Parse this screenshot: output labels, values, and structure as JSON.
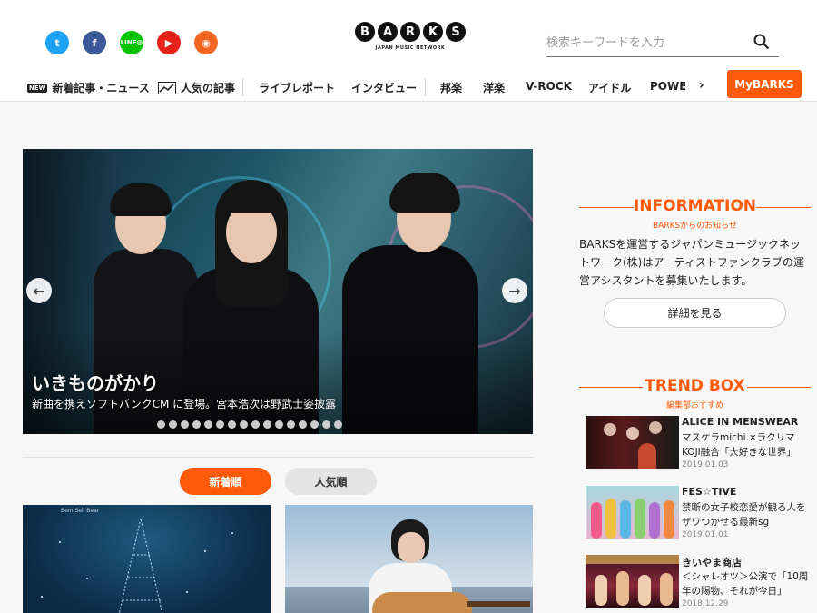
{
  "header": {
    "logo_letters": [
      "B",
      "A",
      "R",
      "K",
      "S"
    ],
    "logo_sub": "JAPAN MUSIC NETWORK",
    "social_icons": [
      "twitter-icon",
      "facebook-icon",
      "line-icon",
      "youtube-icon",
      "rss-icon"
    ],
    "line_label": "LINE@",
    "search_placeholder": "検索キーワードを入力",
    "mybarks_label": "MyBARKS"
  },
  "nav": {
    "new_badge": "NEW",
    "items": [
      "新着記事・ニュース",
      "人気の記事",
      "ライブレポート",
      "インタビュー",
      "邦楽",
      "洋楽",
      "V-ROCK",
      "アイドル",
      "POWER"
    ]
  },
  "hero": {
    "title": "いきものがかり",
    "subtitle": "新曲を携えソフトバンクCM に登場。宮本浩次は野武士姿披露",
    "dot_count": 16
  },
  "tabs": {
    "newest": "新着順",
    "popular": "人気順"
  },
  "cards": {
    "card1_label": "Bem Sell Bear"
  },
  "sidebar": {
    "info": {
      "title": "INFORMATION",
      "subtitle": "BARKSからのお知らせ",
      "text": "BARKSを運営するジャパンミュージックネットワーク(株)はアーティストファンクラブの運営アシスタントを募集いたします。",
      "button": "詳細を見る"
    },
    "trend": {
      "title": "TREND BOX",
      "subtitle": "編集部おすすめ",
      "items": [
        {
          "title": "ALICE IN MENSWEAR",
          "desc": "マスケラmichi.×ラクリマKOJI融合「大好きな世界」",
          "date": "2019.01.03"
        },
        {
          "title": "FES☆TIVE",
          "desc": "禁断の女子校恋愛が観る人をザワつかせる最新sg",
          "date": "2019.01.01"
        },
        {
          "title": "きいやま商店",
          "desc": "＜シャレオツ＞公演で「10周年の賜物、それが今日」",
          "date": "2018.12.29"
        }
      ]
    }
  },
  "colors": {
    "accent": "#ff5a0a",
    "twitter": "#1da1f2",
    "facebook": "#3b5998",
    "line": "#00c300",
    "youtube": "#e62117",
    "rss": "#f26522"
  }
}
